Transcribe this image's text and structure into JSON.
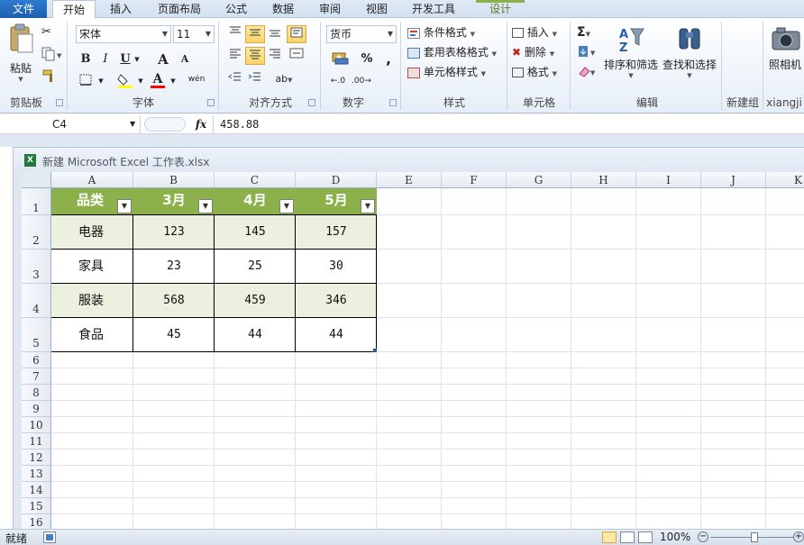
{
  "tabs": {
    "file": "文件",
    "items": [
      {
        "label": "开始",
        "active": true
      },
      {
        "label": "插入"
      },
      {
        "label": "页面布局"
      },
      {
        "label": "公式"
      },
      {
        "label": "数据"
      },
      {
        "label": "审阅"
      },
      {
        "label": "视图"
      },
      {
        "label": "开发工具"
      },
      {
        "label": "设计",
        "contextual": true
      }
    ]
  },
  "ribbon": {
    "clipboard": {
      "label": "剪贴板",
      "paste": "粘贴"
    },
    "font": {
      "label": "字体",
      "name": "宋体",
      "size": "11",
      "bold": "B",
      "italic": "I",
      "underline": "U",
      "grow": "A",
      "shrink": "A",
      "font_color": "A",
      "phonetic": "wén"
    },
    "alignment": {
      "label": "对齐方式"
    },
    "number": {
      "label": "数字",
      "format": "货币",
      "percent": "%",
      "comma": ","
    },
    "styles": {
      "label": "样式",
      "conditional": "条件格式",
      "as_table": "套用表格格式",
      "cell_styles": "单元格样式"
    },
    "cells": {
      "label": "单元格",
      "insert": "插入",
      "delete": "删除",
      "format": "格式"
    },
    "editing": {
      "label": "编辑",
      "sigma": "Σ",
      "sort_filter": "排序和筛选",
      "find_select": "查找和选择"
    },
    "newgroup": {
      "label": "新建组"
    },
    "xiangji": {
      "label": "xiangji",
      "camera": "照相机"
    }
  },
  "formula_bar": {
    "name_box": "C4",
    "fx": "fx",
    "value": "458.88"
  },
  "workbook": {
    "title": "新建 Microsoft Excel 工作表.xlsx"
  },
  "columns": [
    "A",
    "B",
    "C",
    "D",
    "E",
    "F",
    "G",
    "H",
    "I",
    "J",
    "K"
  ],
  "rows": [
    "1",
    "2",
    "3",
    "4",
    "5",
    "6",
    "7",
    "8",
    "9",
    "10",
    "11",
    "12",
    "13",
    "14",
    "15",
    "16"
  ],
  "table": {
    "headers": [
      "品类",
      "3月",
      "4月",
      "5月"
    ],
    "rows": [
      [
        "电器",
        "123",
        "145",
        "157"
      ],
      [
        "家具",
        "23",
        "25",
        "30"
      ],
      [
        "服装",
        "568",
        "459",
        "346"
      ],
      [
        "食品",
        "45",
        "44",
        "44"
      ]
    ],
    "header_color": "#8cb04a",
    "band_color": "#ebf1de"
  },
  "status": {
    "ready": "就绪",
    "zoom": "100%"
  }
}
